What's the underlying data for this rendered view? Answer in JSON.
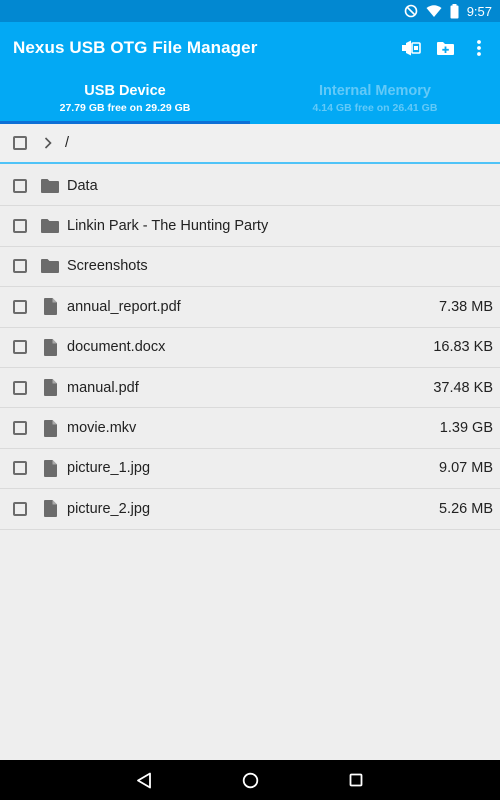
{
  "status_bar": {
    "time": "9:57"
  },
  "app_bar": {
    "title": "Nexus USB OTG File Manager",
    "actions": [
      "swap-storage-icon",
      "new-folder-icon",
      "overflow-menu-icon"
    ]
  },
  "tabs": [
    {
      "label": "USB Device",
      "subtitle": "27.79 GB free on 29.29 GB",
      "active": true
    },
    {
      "label": "Internal Memory",
      "subtitle": "4.14 GB free on 26.41 GB",
      "active": false
    }
  ],
  "path": {
    "text": "/"
  },
  "files": [
    {
      "name": "Data",
      "type": "folder",
      "size": ""
    },
    {
      "name": "Linkin Park - The Hunting Party",
      "type": "folder",
      "size": ""
    },
    {
      "name": "Screenshots",
      "type": "folder",
      "size": ""
    },
    {
      "name": "annual_report.pdf",
      "type": "file",
      "size": "7.38 MB"
    },
    {
      "name": "document.docx",
      "type": "file",
      "size": "16.83 KB"
    },
    {
      "name": "manual.pdf",
      "type": "file",
      "size": "37.48 KB"
    },
    {
      "name": "movie.mkv",
      "type": "file",
      "size": "1.39 GB"
    },
    {
      "name": "picture_1.jpg",
      "type": "file",
      "size": "9.07 MB"
    },
    {
      "name": "picture_2.jpg",
      "type": "file",
      "size": "5.26 MB"
    }
  ],
  "colors": {
    "status_bar": "#0288d1",
    "app_bar": "#03a9f4",
    "tab_indicator": "#0d70d6",
    "icon_gray": "#6b6b6b"
  }
}
